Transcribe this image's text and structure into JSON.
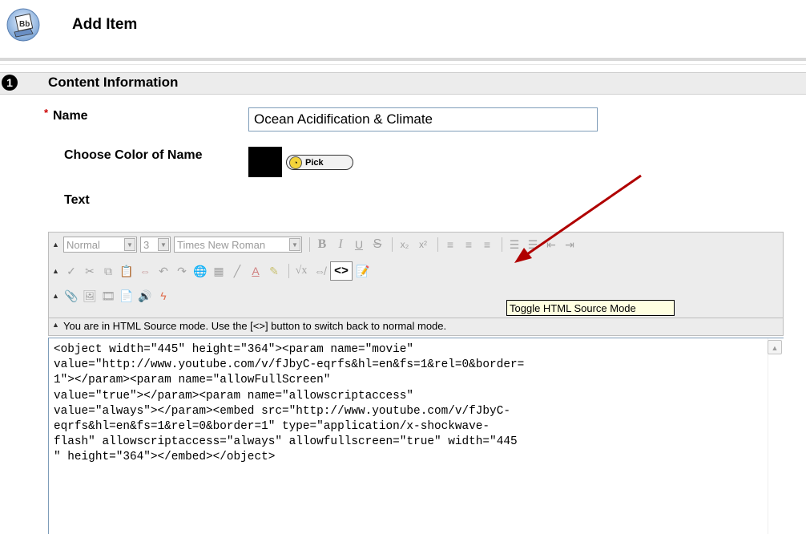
{
  "header": {
    "title": "Add Item",
    "logo_text": "Bb"
  },
  "section": {
    "step": "1",
    "title": "Content Information"
  },
  "form": {
    "required_mark": "*",
    "name_label": "Name",
    "name_value": "Ocean Acidification & Climate",
    "color_label": "Choose Color of Name",
    "pick_label": "Pick",
    "color_value": "#000000",
    "text_label": "Text"
  },
  "editor": {
    "toolbar": {
      "format_select": "Normal",
      "size_select": "3",
      "font_select": "Times New Roman",
      "row1_buttons": [
        "B",
        "I",
        "U",
        "S",
        "x₂",
        "x²",
        "≡",
        "≡",
        "≡",
        "☰",
        "☰",
        "⇤",
        "⇥"
      ],
      "source_toggle_label": "<>"
    },
    "tooltip": "Toggle HTML Source Mode",
    "status_message": "You are in HTML Source mode. Use the [<>] button to switch back to normal mode.",
    "source_lines": [
      "<object width=\"445\" height=\"364\"><param name=\"movie\"",
      "value=\"http://www.youtube.com/v/fJbyC-eqrfs&hl=en&fs=1&rel=0&border=",
      "1\"></param><param name=\"allowFullScreen\"",
      "value=\"true\"></param><param name=\"allowscriptaccess\"",
      "value=\"always\"></param><embed src=\"http://www.youtube.com/v/fJbyC-",
      "eqrfs&hl=en&fs=1&rel=0&border=1\" type=\"application/x-shockwave-",
      "flash\" allowscriptaccess=\"always\" allowfullscreen=\"true\" width=\"445",
      "\" height=\"364\"></embed></object>"
    ]
  },
  "annotation": {
    "arrow_color": "#b00000"
  }
}
